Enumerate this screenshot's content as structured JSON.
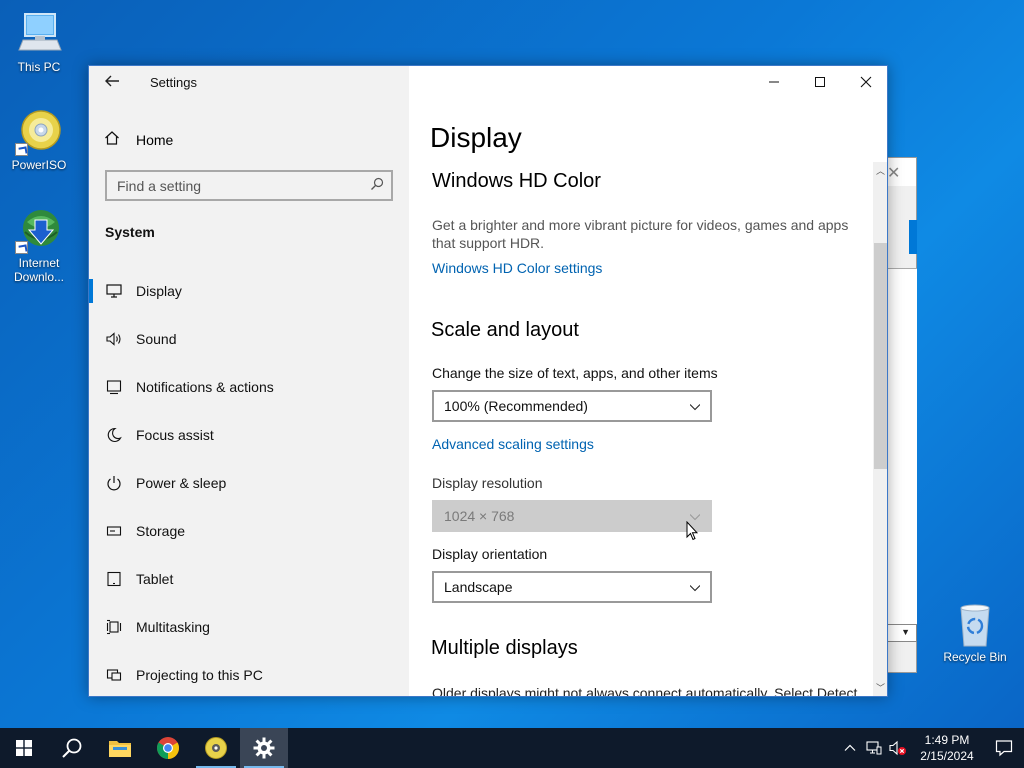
{
  "desktop": {
    "icons": [
      {
        "label": "This PC"
      },
      {
        "label": "PowerISO"
      },
      {
        "label": "Internet Downlo..."
      }
    ],
    "recycle_bin": "Recycle Bin"
  },
  "settings": {
    "title": "Settings",
    "home_label": "Home",
    "search_placeholder": "Find a setting",
    "section": "System",
    "nav": [
      {
        "label": "Display",
        "icon": "monitor-icon",
        "active": true
      },
      {
        "label": "Sound",
        "icon": "speaker-icon"
      },
      {
        "label": "Notifications & actions",
        "icon": "notification-icon"
      },
      {
        "label": "Focus assist",
        "icon": "moon-icon"
      },
      {
        "label": "Power & sleep",
        "icon": "power-icon"
      },
      {
        "label": "Storage",
        "icon": "storage-icon"
      },
      {
        "label": "Tablet",
        "icon": "tablet-icon"
      },
      {
        "label": "Multitasking",
        "icon": "multitasking-icon"
      },
      {
        "label": "Projecting to this PC",
        "icon": "projecting-icon"
      }
    ],
    "page_title": "Display",
    "hdr": {
      "heading": "Windows HD Color",
      "description": "Get a brighter and more vibrant picture for videos, games and apps that support HDR.",
      "link": "Windows HD Color settings"
    },
    "scale": {
      "heading": "Scale and layout",
      "size_label": "Change the size of text, apps, and other items",
      "size_value": "100% (Recommended)",
      "advanced_link": "Advanced scaling settings",
      "resolution_label": "Display resolution",
      "resolution_value": "1024 × 768",
      "orientation_label": "Display orientation",
      "orientation_value": "Landscape"
    },
    "multiple": {
      "heading": "Multiple displays",
      "description": "Older displays might not always connect automatically. Select Detect"
    }
  },
  "taskbar": {
    "time": "1:49 PM",
    "date": "2/15/2024"
  },
  "colors": {
    "accent": "#0078d7",
    "link": "#0063b1",
    "taskbar": "#0e1a2b"
  }
}
